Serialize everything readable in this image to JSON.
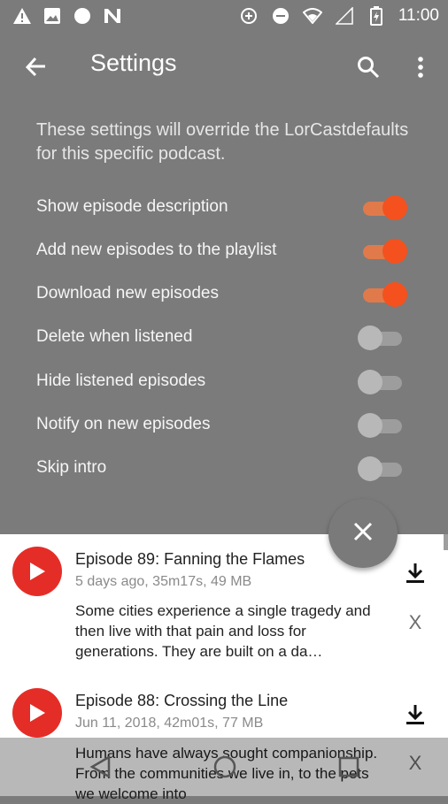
{
  "status_bar": {
    "time": "11:00",
    "left_icons": [
      "warning-icon",
      "image-icon",
      "circle-icon",
      "n-icon"
    ],
    "right_icons": [
      "data-saver-icon",
      "do-not-disturb-icon",
      "wifi-icon",
      "signal-icon",
      "battery-charging-icon"
    ]
  },
  "app_bar": {
    "title": "Settings"
  },
  "description": "These settings will override the LorCastdefaults for this specific podcast.",
  "settings": [
    {
      "label": "Show episode description",
      "on": true
    },
    {
      "label": "Add new episodes to the playlist",
      "on": true
    },
    {
      "label": "Download new episodes",
      "on": true
    },
    {
      "label": "Delete when listened",
      "on": false
    },
    {
      "label": "Hide listened episodes",
      "on": false
    },
    {
      "label": "Notify on new episodes",
      "on": false
    },
    {
      "label": "Skip intro",
      "on": false
    }
  ],
  "fab_icon": "close-icon",
  "episodes": [
    {
      "title": "Episode 89: Fanning the Flames",
      "meta": "5 days ago, 35m17s, 49 MB",
      "description": "Some cities experience a single tragedy and then live with that pain and loss for generations. They are built on a da…",
      "dismiss": "X"
    },
    {
      "title": "Episode 88: Crossing the Line",
      "meta": "Jun 11, 2018, 42m01s, 77 MB",
      "description": "Humans have always sought companionship. From the communities we live in, to the pets we welcome into",
      "dismiss": "X"
    }
  ],
  "colors": {
    "accent": "#f4511e",
    "scrim": "#7b7b7b",
    "podcast_logo": "#e52d27"
  }
}
